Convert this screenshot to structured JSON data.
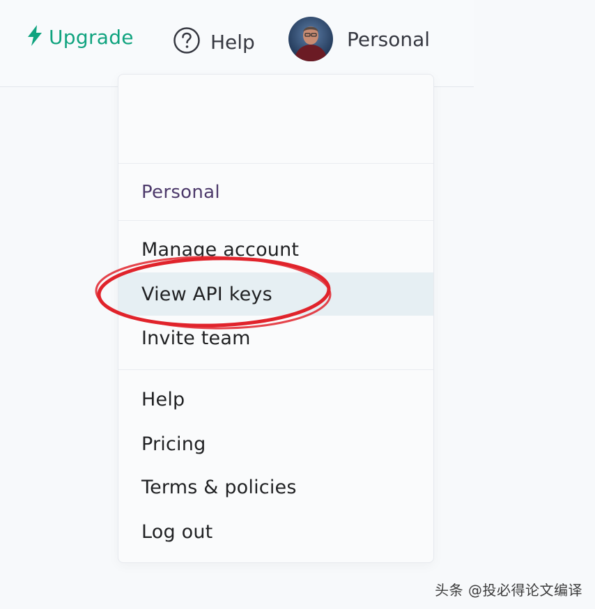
{
  "topbar": {
    "upgrade_label": "Upgrade",
    "help_label": "Help",
    "account_label": "Personal"
  },
  "menu": {
    "section_title": "Personal",
    "items": [
      {
        "label": "Manage account"
      },
      {
        "label": "View API keys",
        "highlighted": true
      },
      {
        "label": "Invite team"
      },
      {
        "label": "Help"
      },
      {
        "label": "Pricing"
      },
      {
        "label": "Terms & policies"
      },
      {
        "label": "Log out"
      }
    ]
  },
  "annotation": {
    "shape": "ellipse",
    "color": "#e0232b",
    "target": "View API keys"
  },
  "watermark": "头条 @投必得论文编译",
  "colors": {
    "accent": "#10a37f",
    "highlight_bg": "#e6eff3",
    "annotation_red": "#e0232b"
  },
  "icons": {
    "upgrade": "lightning-bolt-icon",
    "help": "question-circle-icon",
    "account": "user-avatar"
  }
}
